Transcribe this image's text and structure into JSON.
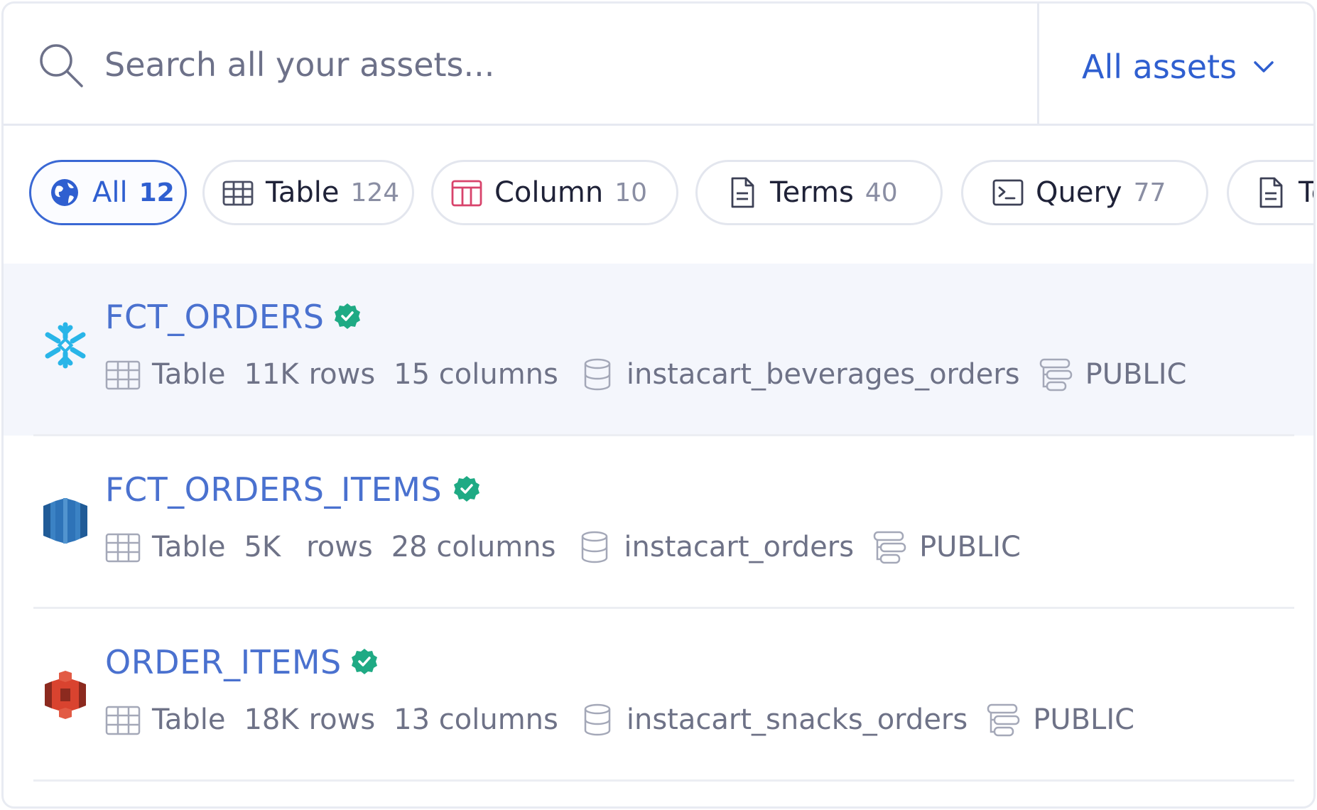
{
  "search": {
    "placeholder": "Search all your assets...",
    "scope_label": "All assets"
  },
  "filters": [
    {
      "label": "All",
      "count": "12",
      "icon": "globe-icon",
      "active": true
    },
    {
      "label": "Table",
      "count": "124",
      "icon": "table-icon"
    },
    {
      "label": "Column",
      "count": "10",
      "icon": "column-icon"
    },
    {
      "label": "Terms",
      "count": "40",
      "icon": "document-icon"
    },
    {
      "label": "Query",
      "count": "77",
      "icon": "terminal-icon"
    },
    {
      "label": "Te",
      "count": "",
      "icon": "document-icon"
    }
  ],
  "results": [
    {
      "title": "FCT_ORDERS",
      "source_icon": "snowflake-icon",
      "type": "Table",
      "rows": "11K",
      "rows_label": "rows",
      "columns": "15 columns",
      "database": "instacart_beverages_orders",
      "schema": "PUBLIC"
    },
    {
      "title": "FCT_ORDERS_ITEMS",
      "source_icon": "redshift-icon",
      "type": "Table",
      "rows": "5K",
      "rows_label": "rows",
      "columns": "28 columns",
      "database": "instacart_orders",
      "schema": "PUBLIC"
    },
    {
      "title": "ORDER_ITEMS",
      "source_icon": "s3-icon",
      "type": "Table",
      "rows": "18K",
      "rows_label": "rows",
      "columns": "13 columns",
      "database": "instacart_snacks_orders",
      "schema": "PUBLIC"
    }
  ],
  "colors": {
    "accent": "#2f5fd0",
    "title": "#4a71cf",
    "verified": "#1faa84",
    "row_highlight": "#f4f6fc"
  }
}
